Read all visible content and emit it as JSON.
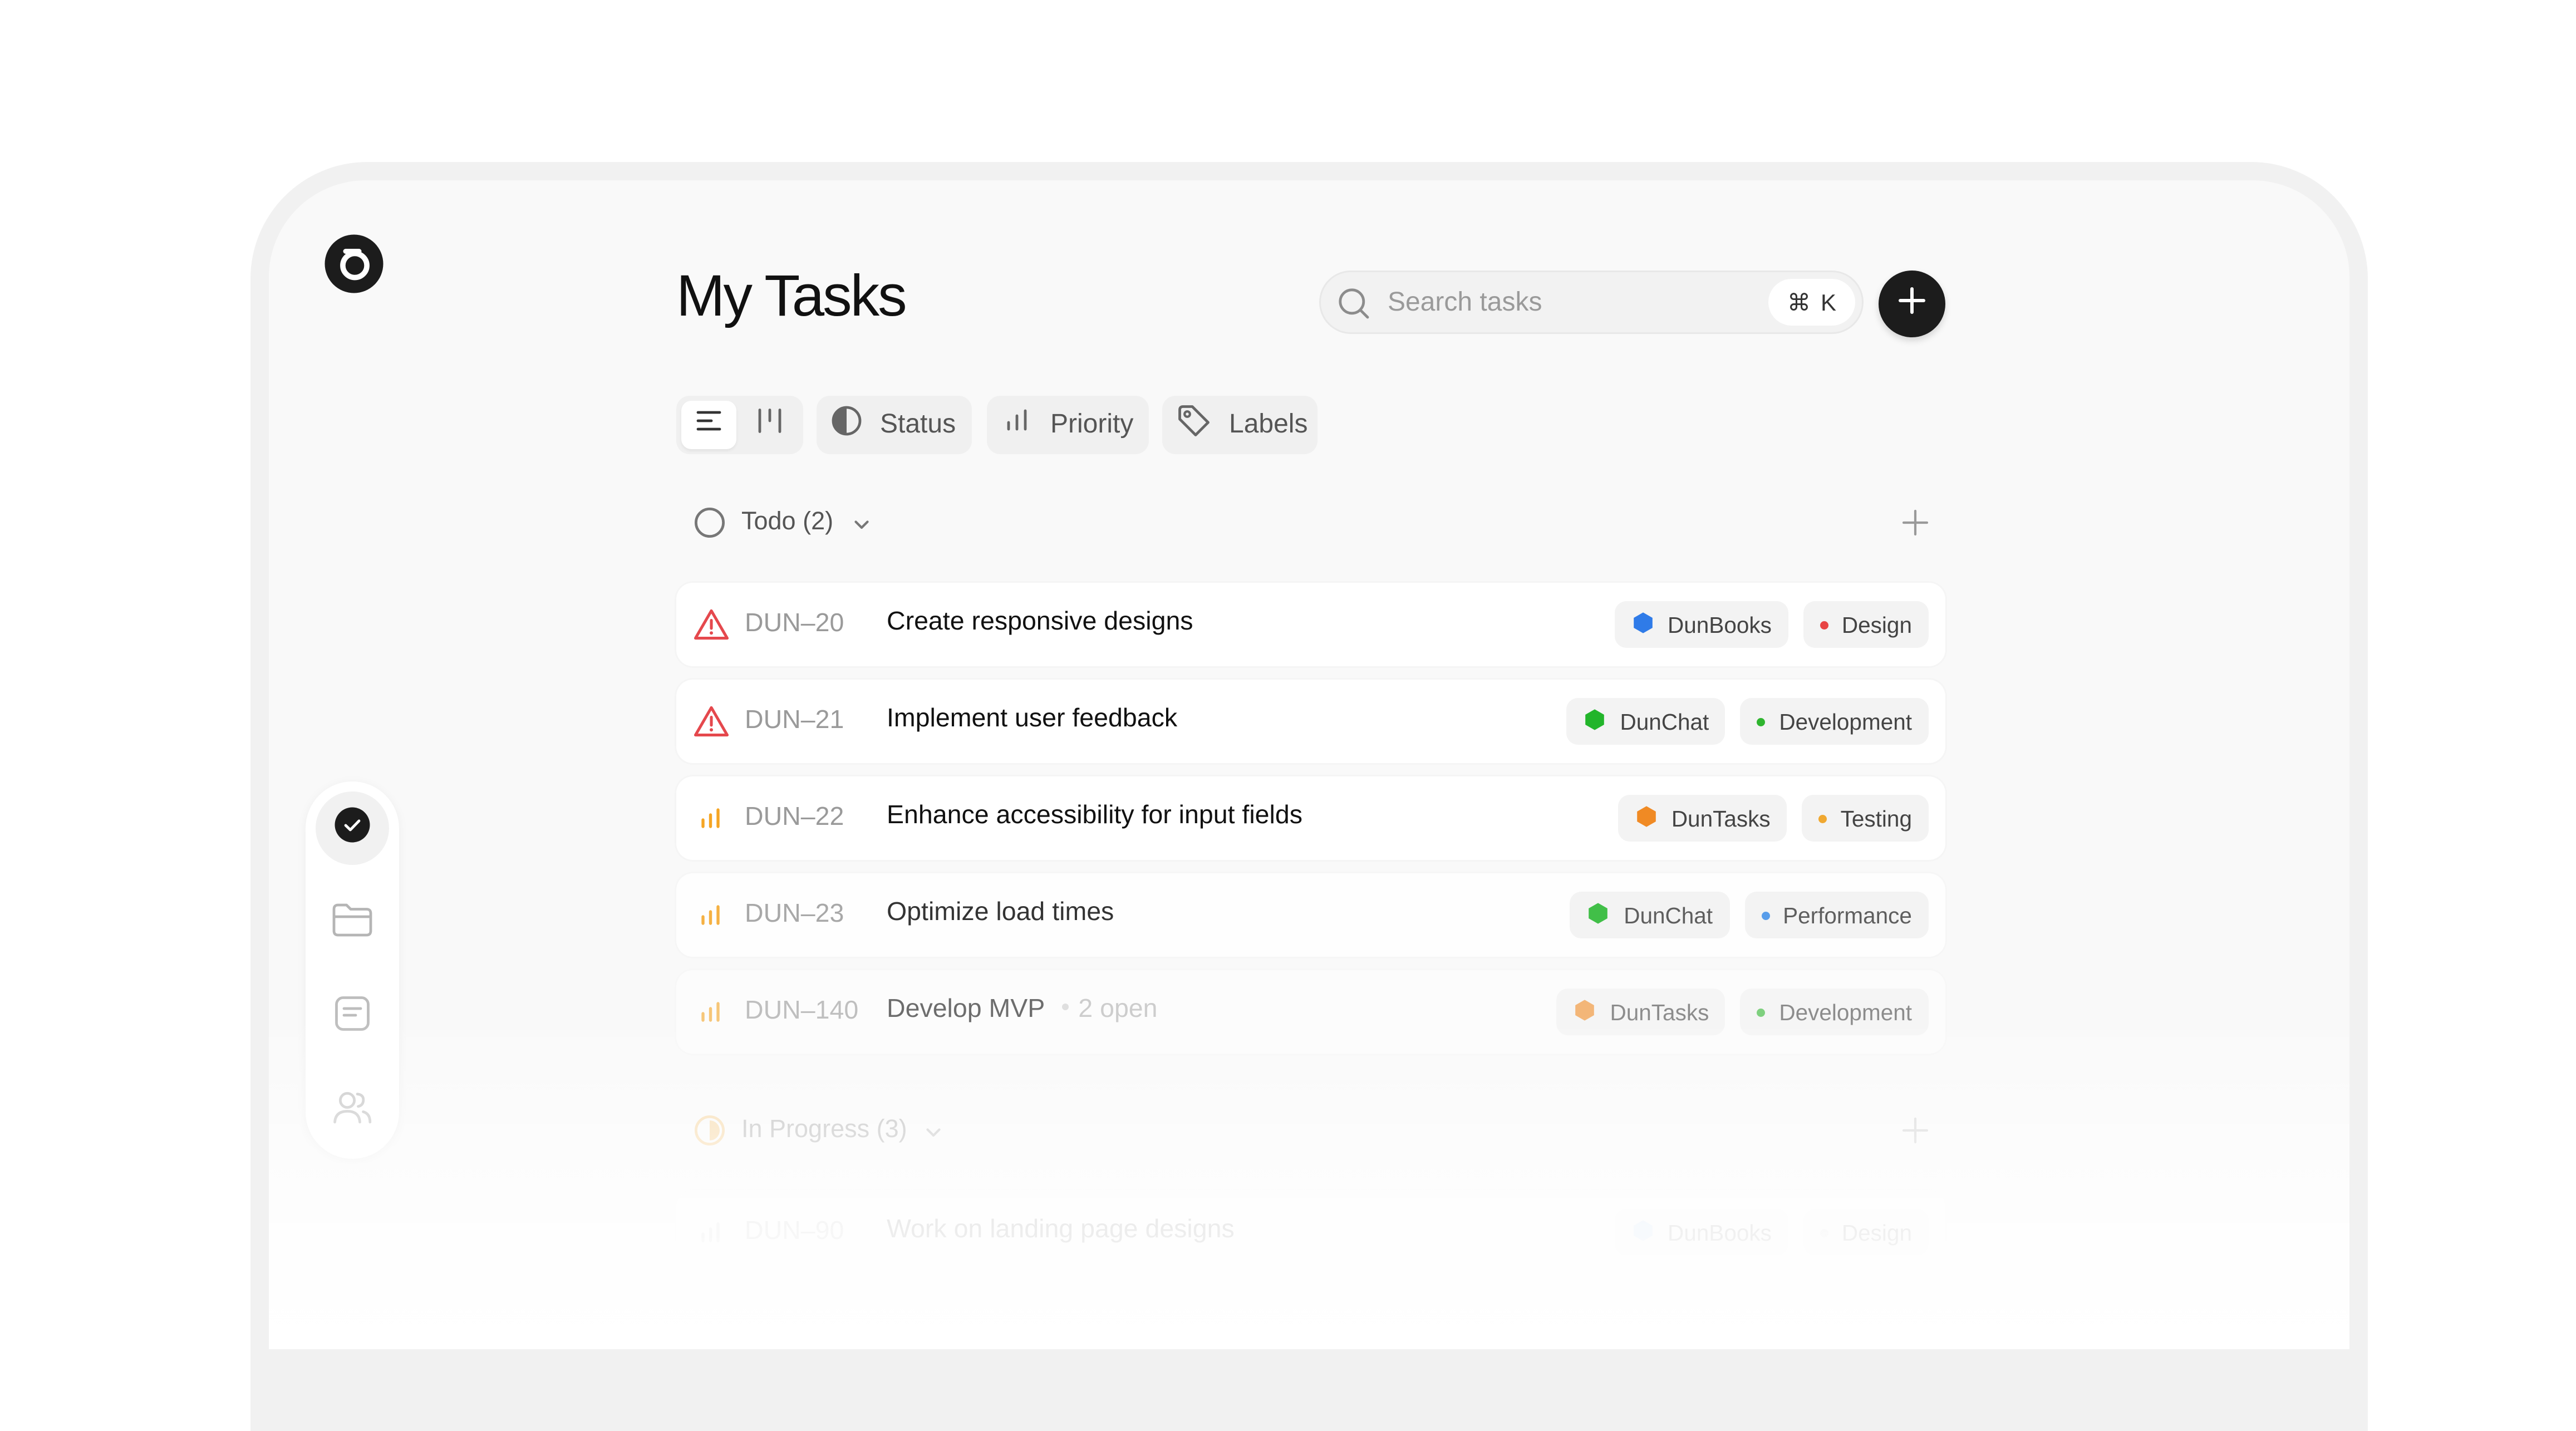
{
  "page": {
    "title": "My Tasks"
  },
  "search": {
    "placeholder": "Search tasks",
    "shortcut_symbol": "⌘",
    "shortcut_key": "K"
  },
  "toolbar": {
    "filters": [
      {
        "label": "Status",
        "icon": "half-circle-icon"
      },
      {
        "label": "Priority",
        "icon": "bar-chart-icon"
      },
      {
        "label": "Labels",
        "icon": "tag-icon"
      }
    ]
  },
  "sidebar": {
    "items": [
      {
        "name": "tasks",
        "icon": "check-circle-icon",
        "active": true
      },
      {
        "name": "projects",
        "icon": "folder-icon",
        "active": false
      },
      {
        "name": "notes",
        "icon": "document-icon",
        "active": false
      },
      {
        "name": "team",
        "icon": "users-icon",
        "active": false
      }
    ]
  },
  "groups": [
    {
      "label": "Todo (2)",
      "icon": "empty-circle-icon",
      "tasks": [
        {
          "id": "DUN–20",
          "title": "Create responsive designs",
          "extra": "",
          "priority": "urgent",
          "project": "DunBooks",
          "project_color": "#2f7be8",
          "label": "Design",
          "label_color": "#e84545"
        },
        {
          "id": "DUN–21",
          "title": "Implement user feedback",
          "extra": "",
          "priority": "urgent",
          "project": "DunChat",
          "project_color": "#22b52a",
          "label": "Development",
          "label_color": "#2fb52f"
        },
        {
          "id": "DUN–22",
          "title": "Enhance accessibility for input fields",
          "extra": "",
          "priority": "medium",
          "project": "DunTasks",
          "project_color": "#f08a24",
          "label": "Testing",
          "label_color": "#f0a830"
        },
        {
          "id": "DUN–23",
          "title": "Optimize load times",
          "extra": "",
          "priority": "medium",
          "project": "DunChat",
          "project_color": "#22b52a",
          "label": "Performance",
          "label_color": "#3d8ee8"
        },
        {
          "id": "DUN–140",
          "title": "Develop MVP",
          "extra": "2 open",
          "priority": "medium",
          "project": "DunTasks",
          "project_color": "#f08a24",
          "label": "Development",
          "label_color": "#2fb52f"
        }
      ]
    },
    {
      "label": "In Progress (3)",
      "icon": "half-filled-circle-icon",
      "tasks": [
        {
          "id": "DUN–90",
          "title": "Work on landing page designs",
          "extra": "",
          "priority": "low",
          "project": "DunBooks",
          "project_color": "#2f7be8",
          "label": "Design",
          "label_color": "#e84545"
        }
      ]
    }
  ],
  "colors": {
    "urgent": "#e5484d",
    "medium_priority": "#f5a524",
    "accent_dark": "#1c1c1c"
  }
}
